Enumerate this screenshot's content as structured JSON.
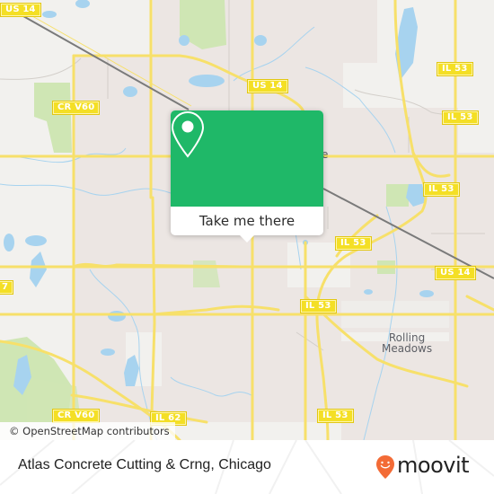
{
  "map": {
    "attribution": "© OpenStreetMap contributors",
    "place_labels": [
      {
        "id": "rolling-meadows",
        "line1": "Rolling",
        "line2": "Meadows"
      }
    ],
    "road_shields": [
      {
        "id": "us14-topleft",
        "label": "US 14"
      },
      {
        "id": "cr-v60-top",
        "label": "CR V60"
      },
      {
        "id": "us14-mid",
        "label": "US 14"
      },
      {
        "id": "il53-topright",
        "label": "IL 53"
      },
      {
        "id": "il53-right1",
        "label": "IL 53"
      },
      {
        "id": "il53-right2",
        "label": "IL 53"
      },
      {
        "id": "il53-center",
        "label": "IL 53"
      },
      {
        "id": "us14-right",
        "label": "US 14"
      },
      {
        "id": "il53-mid",
        "label": "IL 53"
      },
      {
        "id": "il53-bottom",
        "label": "IL 53"
      },
      {
        "id": "cr-v60-bottom",
        "label": "CR V60"
      },
      {
        "id": "il62",
        "label": "IL 62"
      },
      {
        "id": "edge-7",
        "label": "7"
      }
    ],
    "colors": {
      "land": "#f2f1ee",
      "urban": "#ece6e3",
      "park": "#cfe6b4",
      "water": "#a7d3ef",
      "road_major": "#f7e06a",
      "shield": "#f4df25"
    }
  },
  "popup": {
    "icon": "map-pin-icon",
    "button_label": "Take me there",
    "accent": "#1fb868"
  },
  "footer": {
    "title": "Atlas Concrete Cutting & Crng, Chicago",
    "brand": "moovit",
    "brand_color": "#f36b36"
  }
}
